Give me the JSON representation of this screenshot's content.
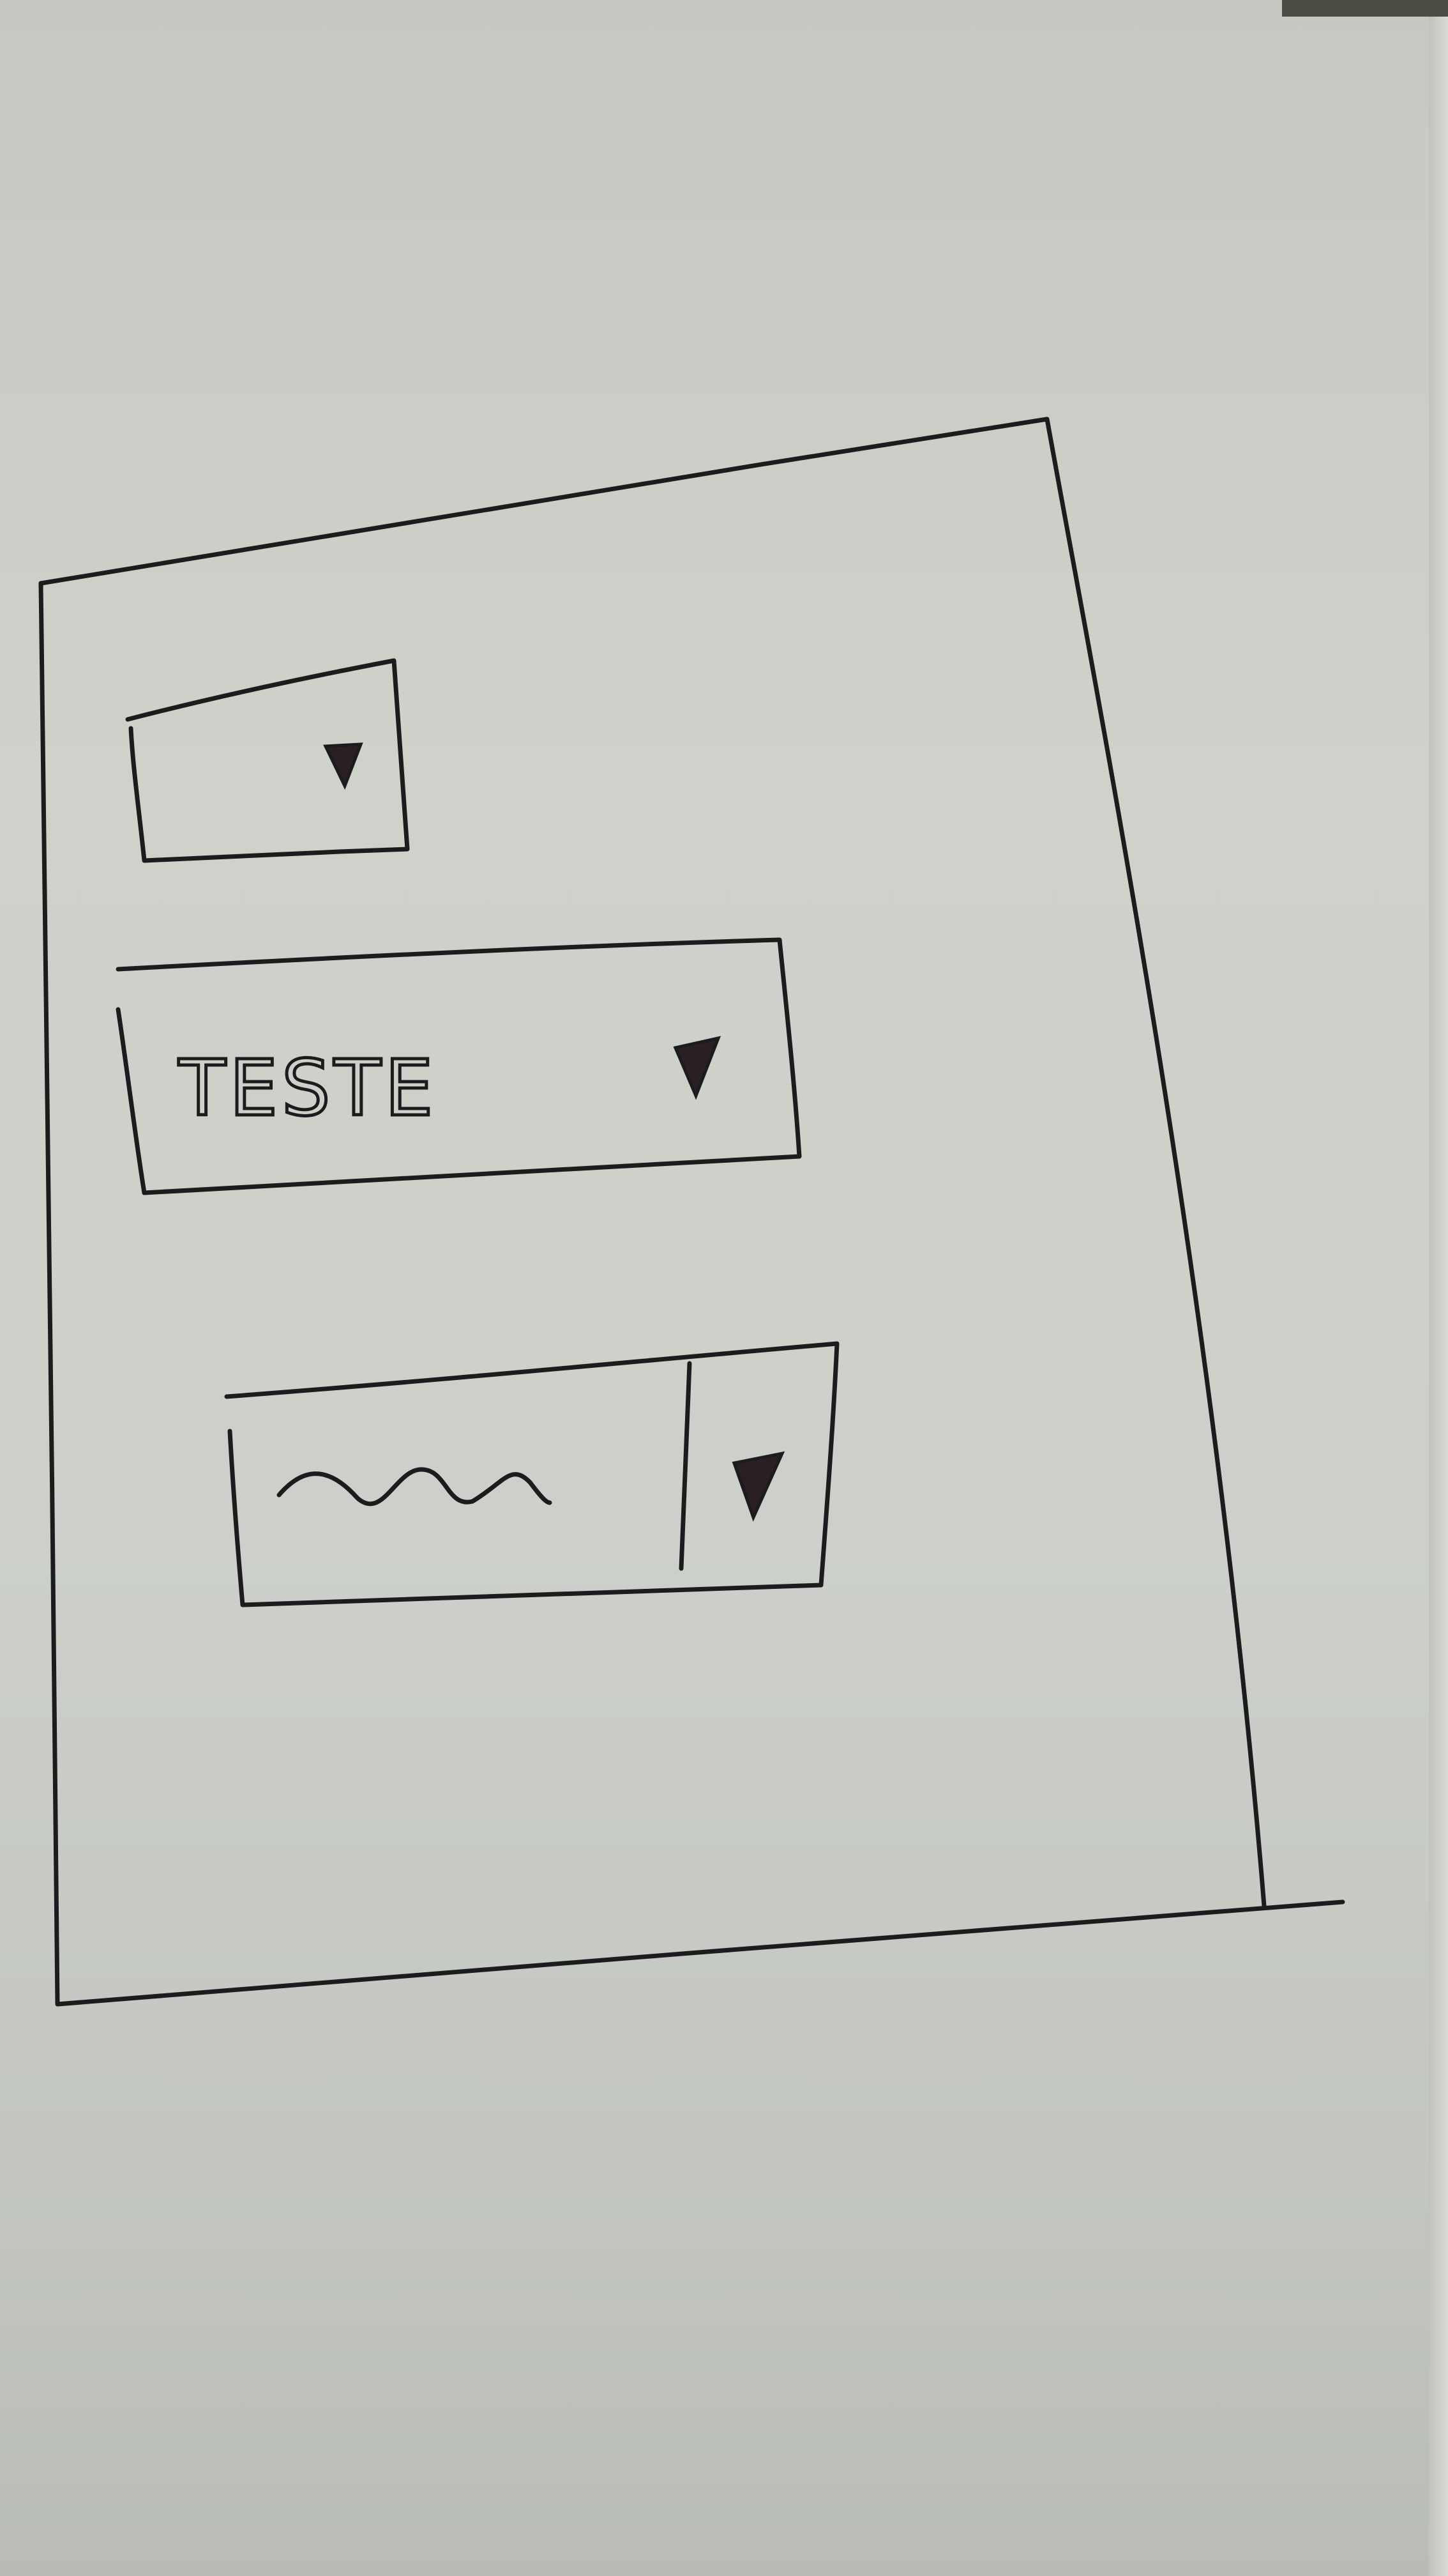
{
  "sketch": {
    "ink_color": "#1c1c1e",
    "paper_color": "#cfd1cb",
    "dropdowns": [
      {
        "value": "",
        "arrow_icon": "caret-down-icon"
      },
      {
        "value": "TESTE",
        "arrow_icon": "caret-down-icon"
      },
      {
        "value_placeholder": "squiggle",
        "arrow_icon": "caret-down-icon",
        "has_divider": true
      }
    ]
  }
}
